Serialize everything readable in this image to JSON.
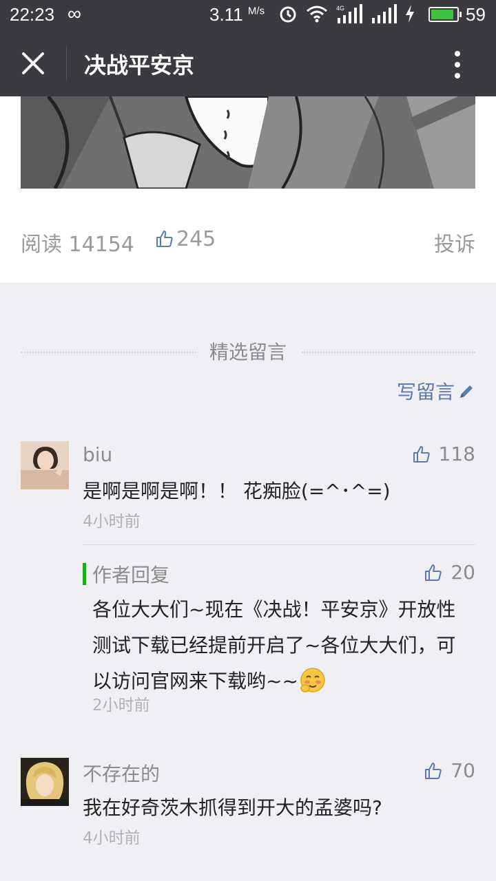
{
  "status_bar": {
    "time": "22:23",
    "infinity_glyph": "∞",
    "network_speed": "3.11",
    "speed_unit": "M/s",
    "battery_percent": "59",
    "icons": [
      "infinity-icon",
      "alarm-icon",
      "wifi-icon",
      "signal-4g-icon",
      "signal-icon",
      "charging-icon",
      "battery-icon"
    ]
  },
  "nav": {
    "title": "决战平安京",
    "close_icon": "close-icon",
    "more_icon": "more-vert-icon"
  },
  "article": {
    "reads_label": "阅读 14154",
    "likes_count": "245",
    "report_label": "投诉"
  },
  "comments_section": {
    "heading": "精选留言",
    "write_label": "写留言"
  },
  "comments": [
    {
      "name": "biu",
      "text": "是啊是啊是啊！！ 花痴脸(=^･^=)",
      "time": "4小时前",
      "likes": "118",
      "reply": {
        "label": "作者回复",
        "text": "各位大大们~现在《决战！平安京》开放性测试下载已经提前开启了~各位大大们，可以访问官网来下载哟~~",
        "time": "2小时前",
        "likes": "20"
      }
    },
    {
      "name": "不存在的",
      "text": "我在好奇茨木抓得到开大的孟婆吗?",
      "time": "4小时前",
      "likes": "70"
    }
  ],
  "colors": {
    "bar_bg": "#3a3a3f",
    "page_bg": "#efeff4",
    "link_blue": "#5a7bab",
    "reply_green": "#1aad19"
  }
}
